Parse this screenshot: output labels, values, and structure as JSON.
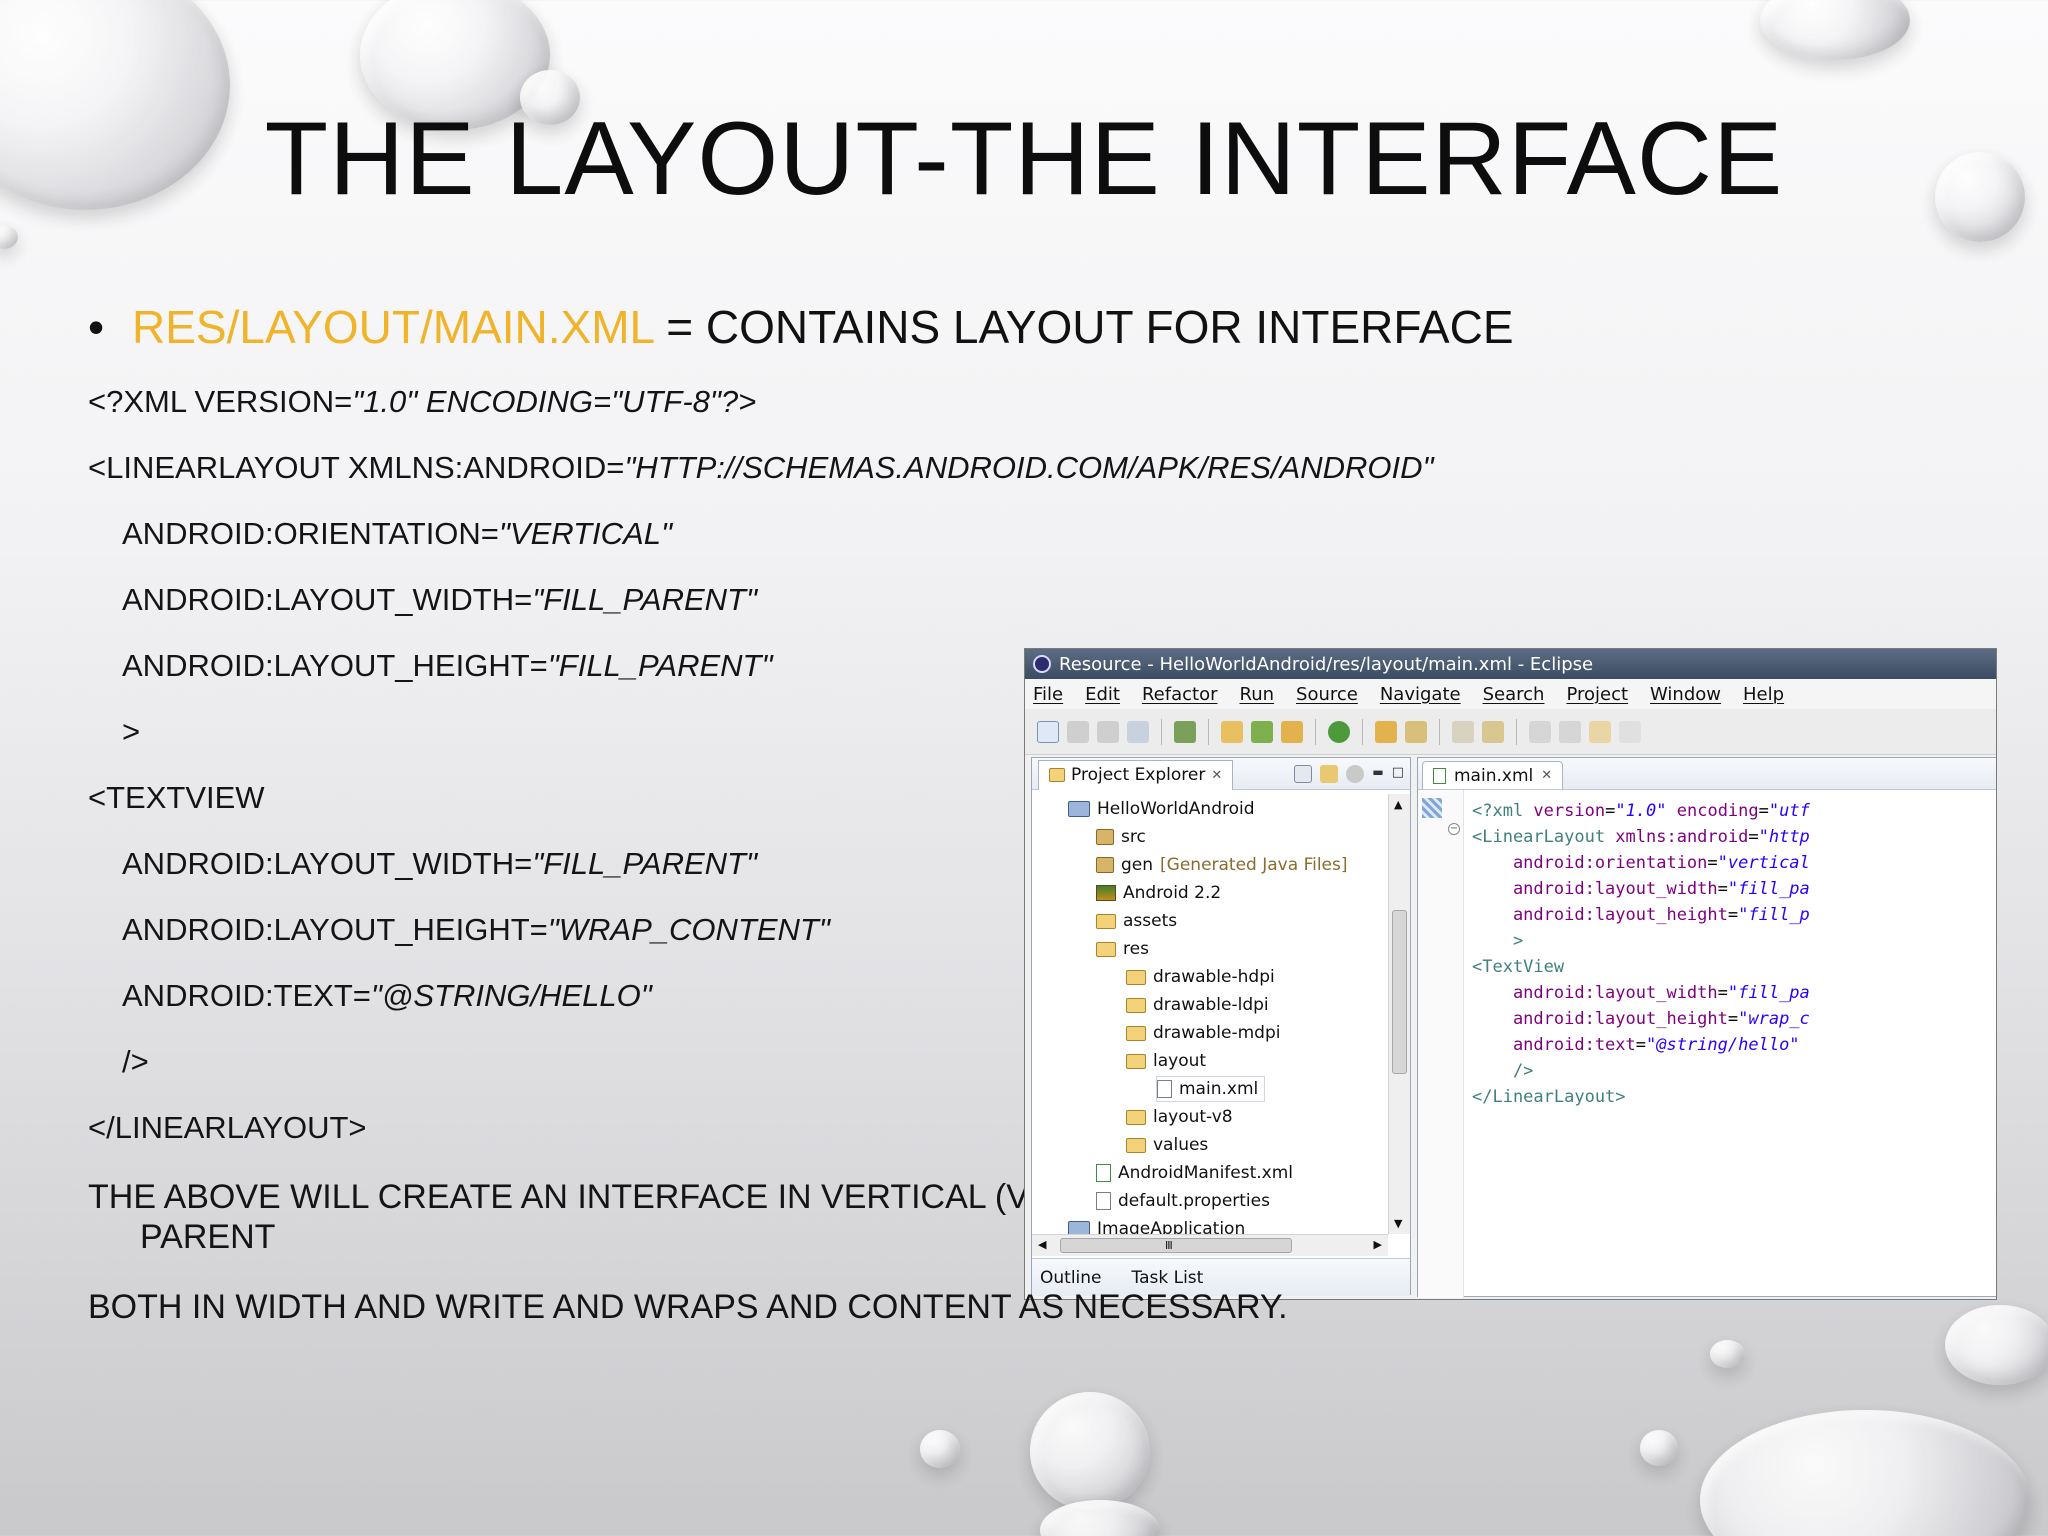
{
  "slide": {
    "title": "THE LAYOUT-THE INTERFACE",
    "bullet": {
      "symbol": "•",
      "highlight": "RES/LAYOUT/MAIN.XML",
      "rest": " = CONTAINS LAYOUT FOR INTERFACE"
    },
    "code_lines": [
      {
        "plain": "<?XML VERSION=",
        "italic": "\"1.0\" ENCODING=\"UTF-8\"?>"
      },
      {
        "plain": "<LINEARLAYOUT XMLNS:ANDROID=",
        "italic": "\"HTTP://SCHEMAS.ANDROID.COM/APK/RES/ANDROID\""
      },
      {
        "plain": "ANDROID:ORIENTATION=",
        "italic": "\"VERTICAL\""
      },
      {
        "plain": "ANDROID:LAYOUT_WIDTH=",
        "italic": "\"FILL_PARENT\""
      },
      {
        "plain": "ANDROID:LAYOUT_HEIGHT=",
        "italic": "\"FILL_PARENT\""
      },
      {
        "plain": ">",
        "italic": ""
      },
      {
        "plain": "<TEXTVIEW",
        "italic": ""
      },
      {
        "plain": "ANDROID:LAYOUT_WIDTH=",
        "italic": "\"FILL_PARENT\""
      },
      {
        "plain": "ANDROID:LAYOUT_HEIGHT=",
        "italic": "\"WRAP_CONTENT\""
      },
      {
        "plain": "ANDROID:TEXT=",
        "italic": "\"@STRING/HELLO\""
      },
      {
        "plain": "/>",
        "italic": ""
      },
      {
        "plain": "</LINEARLAYOUT>",
        "italic": ""
      }
    ],
    "desc_line1": "THE ABOVE WILL CREATE AN INTERFACE IN VERTICAL (V",
    "desc_line2": "PARENT",
    "desc_line3": "BOTH IN WIDTH AND WRITE AND WRAPS AND CONTENT AS NECESSARY.",
    "accent_color": "#f1b32a"
  },
  "eclipse": {
    "window_title": "Resource - HelloWorldAndroid/res/layout/main.xml - Eclipse",
    "menu": [
      "File",
      "Edit",
      "Refactor",
      "Run",
      "Source",
      "Navigate",
      "Search",
      "Project",
      "Window",
      "Help"
    ],
    "project_explorer": {
      "tab_label": "Project Explorer",
      "close_glyph": "✕",
      "items": [
        {
          "label": "HelloWorldAndroid",
          "icon": "project-icon"
        },
        {
          "label": "src",
          "icon": "package-folder-icon"
        },
        {
          "label": "gen",
          "note": "[Generated Java Files]",
          "icon": "package-folder-icon"
        },
        {
          "label": "Android 2.2",
          "icon": "library-icon"
        },
        {
          "label": "assets",
          "icon": "folder-icon"
        },
        {
          "label": "res",
          "icon": "folder-icon"
        },
        {
          "label": "drawable-hdpi",
          "icon": "folder-icon"
        },
        {
          "label": "drawable-ldpi",
          "icon": "folder-icon"
        },
        {
          "label": "drawable-mdpi",
          "icon": "folder-icon"
        },
        {
          "label": "layout",
          "icon": "folder-icon"
        },
        {
          "label": "main.xml",
          "icon": "xml-file-icon"
        },
        {
          "label": "layout-v8",
          "icon": "folder-icon"
        },
        {
          "label": "values",
          "icon": "folder-icon"
        },
        {
          "label": "AndroidManifest.xml",
          "icon": "manifest-file-icon"
        },
        {
          "label": "default.properties",
          "icon": "file-icon"
        },
        {
          "label": "ImageApplication",
          "icon": "project-icon"
        }
      ],
      "hscroll_glyph": "III"
    },
    "bottom_tabs": [
      "Outline",
      "Task List"
    ],
    "editor": {
      "tab_label": "main.xml",
      "close_glyph": "✕",
      "lines": [
        {
          "parts": [
            [
              "tag",
              "<?xml "
            ],
            [
              "attr",
              "version"
            ],
            [
              "punc",
              "="
            ],
            [
              "val",
              "\"1.0\""
            ],
            [
              "attr",
              " encoding"
            ],
            [
              "punc",
              "="
            ],
            [
              "val",
              "\"utf"
            ]
          ]
        },
        {
          "parts": [
            [
              "tag",
              "<LinearLayout "
            ],
            [
              "attr",
              "xmlns:android"
            ],
            [
              "punc",
              "="
            ],
            [
              "val",
              "\"http"
            ]
          ]
        },
        {
          "parts": [
            [
              "attr",
              "    android:orientation"
            ],
            [
              "punc",
              "="
            ],
            [
              "val",
              "\"vertical"
            ]
          ]
        },
        {
          "parts": [
            [
              "attr",
              "    android:layout_width"
            ],
            [
              "punc",
              "="
            ],
            [
              "val",
              "\"fill_pa"
            ]
          ]
        },
        {
          "parts": [
            [
              "attr",
              "    android:layout_height"
            ],
            [
              "punc",
              "="
            ],
            [
              "val",
              "\"fill_p"
            ]
          ]
        },
        {
          "parts": [
            [
              "tag",
              "    >"
            ]
          ]
        },
        {
          "parts": [
            [
              "tag",
              "<TextView"
            ]
          ]
        },
        {
          "parts": [
            [
              "attr",
              "    android:layout_width"
            ],
            [
              "punc",
              "="
            ],
            [
              "val",
              "\"fill_pa"
            ]
          ]
        },
        {
          "parts": [
            [
              "attr",
              "    android:layout_height"
            ],
            [
              "punc",
              "="
            ],
            [
              "val",
              "\"wrap_c"
            ]
          ]
        },
        {
          "parts": [
            [
              "attr",
              "    android:text"
            ],
            [
              "punc",
              "="
            ],
            [
              "val",
              "\"@string/hello\""
            ]
          ]
        },
        {
          "parts": [
            [
              "tag",
              "    />"
            ]
          ]
        },
        {
          "parts": [
            [
              "tag",
              "</LinearLayout>"
            ]
          ]
        }
      ]
    }
  }
}
